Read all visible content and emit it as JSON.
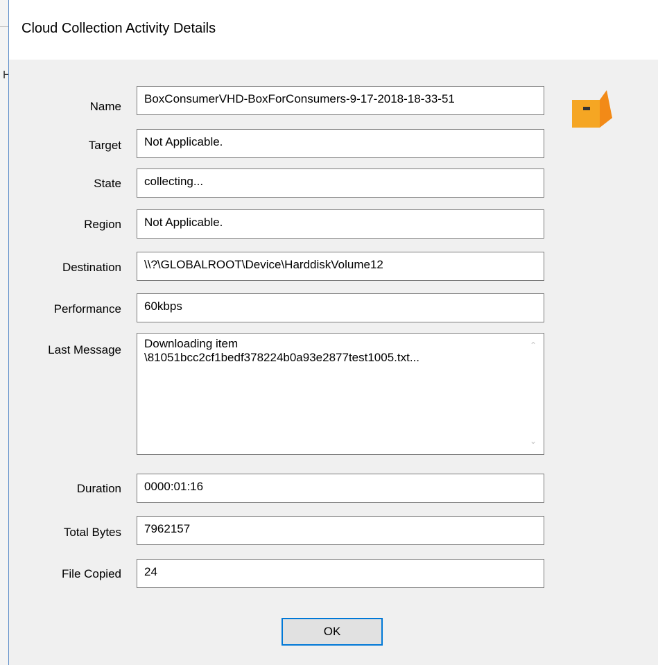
{
  "dialog": {
    "title": "Cloud Collection Activity Details",
    "fields": {
      "name": {
        "label": "Name",
        "value": "BoxConsumerVHD-BoxForConsumers-9-17-2018-18-33-51"
      },
      "target": {
        "label": "Target",
        "value": "Not Applicable."
      },
      "state": {
        "label": "State",
        "value": "collecting..."
      },
      "region": {
        "label": "Region",
        "value": "Not Applicable."
      },
      "destination": {
        "label": "Destination",
        "value": "\\\\?\\GLOBALROOT\\Device\\HarddiskVolume12"
      },
      "performance": {
        "label": "Performance",
        "value": "60kbps"
      },
      "last_message": {
        "label": "Last Message",
        "value": "Downloading item\n\\81051bcc2cf1bedf378224b0a93e2877test1005.txt..."
      },
      "duration": {
        "label": "Duration",
        "value": "0000:01:16"
      },
      "total_bytes": {
        "label": "Total Bytes",
        "value": "7962157"
      },
      "file_copied": {
        "label": "File Copied",
        "value": "24"
      }
    },
    "ok_label": "OK",
    "icon": "box-logo-icon",
    "accent_color": "#0078d7",
    "icon_color": "#f5a623"
  },
  "background": {
    "partial_letter": "H"
  }
}
